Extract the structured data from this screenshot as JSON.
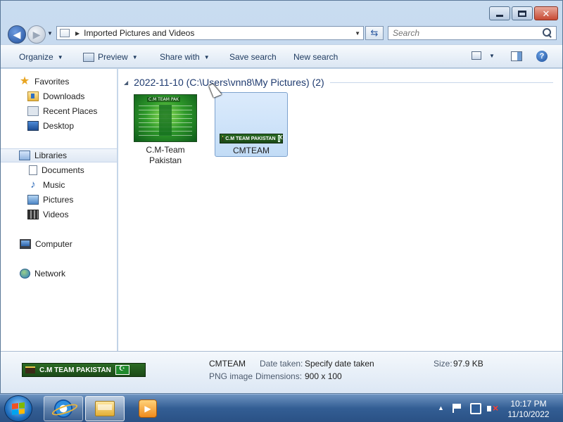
{
  "window": {
    "controls": [
      "minimize",
      "maximize",
      "close"
    ]
  },
  "address": {
    "path": "Imported Pictures and Videos"
  },
  "search": {
    "placeholder": "Search"
  },
  "toolbar": {
    "organize": "Organize",
    "preview": "Preview",
    "share_with": "Share with",
    "save_search": "Save search",
    "new_search": "New search"
  },
  "sidebar": {
    "favorites": "Favorites",
    "downloads": "Downloads",
    "recent_places": "Recent Places",
    "desktop": "Desktop",
    "libraries": "Libraries",
    "documents": "Documents",
    "music": "Music",
    "pictures": "Pictures",
    "videos": "Videos",
    "computer": "Computer",
    "network": "Network"
  },
  "content": {
    "group_title": "2022-11-10 (C:\\Users\\vnn8\\My Pictures) (2)",
    "files": [
      {
        "name_line1": "C.M-Team",
        "name_line2": "Pakistan",
        "thumb_title": "C.M TEAM PAK"
      },
      {
        "name": "CMTEAM",
        "thumb_text": "C.M TEAM PAKISTAN"
      }
    ]
  },
  "details": {
    "banner_text": "C.M TEAM PAKISTAN",
    "file_name": "CMTEAM",
    "file_type": "PNG image",
    "date_taken_label": "Date taken:",
    "date_taken_value": "Specify date taken",
    "dimensions_label": "Dimensions:",
    "dimensions_value": "900 x 100",
    "size_label": "Size:",
    "size_value": "97.9 KB"
  },
  "taskbar": {
    "apps": [
      "internet-explorer",
      "windows-explorer",
      "windows-media-player"
    ],
    "time": "10:17 PM",
    "date": "11/10/2022"
  },
  "colors": {
    "accent": "#2c5aa0",
    "selection": "#c2dcf6"
  }
}
